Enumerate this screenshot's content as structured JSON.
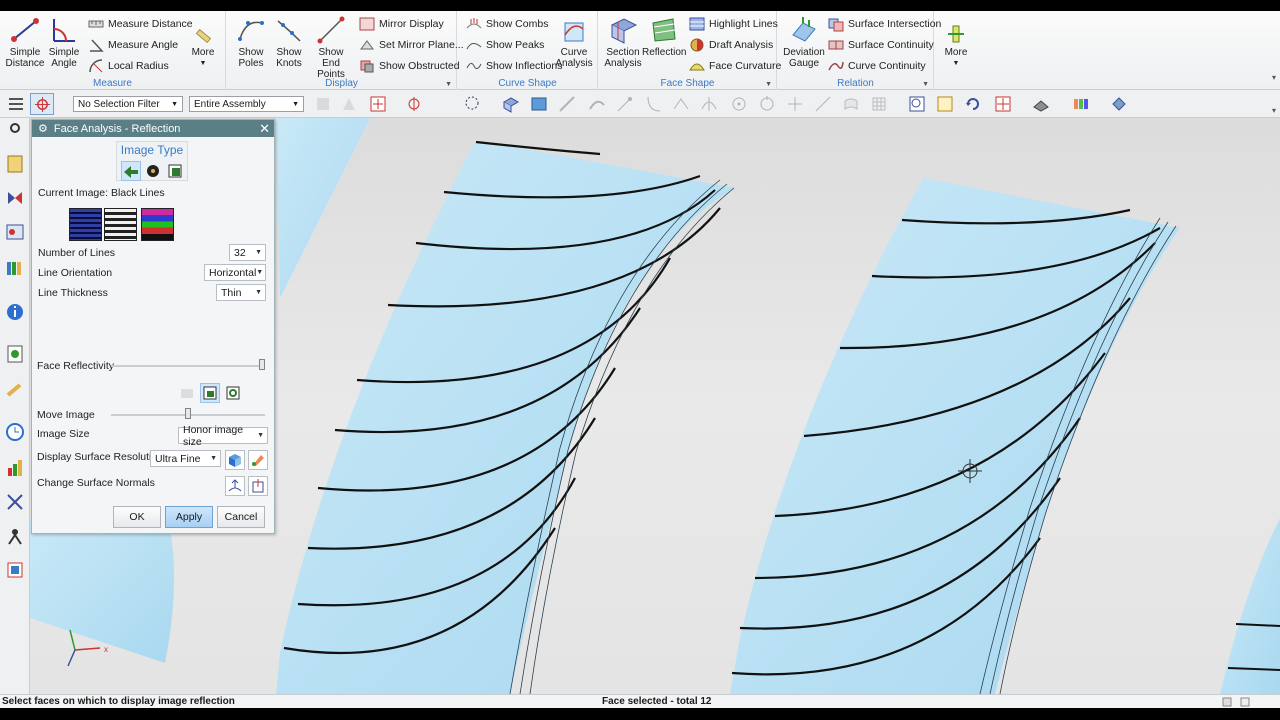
{
  "ribbon": {
    "measure": {
      "label": "Measure",
      "simple_distance": "Simple Distance",
      "simple_angle": "Simple Angle",
      "measure_distance": "Measure Distance",
      "measure_angle": "Measure Angle",
      "local_radius": "Local Radius",
      "more": "More"
    },
    "display": {
      "label": "Display",
      "show_poles": "Show Poles",
      "show_knots": "Show Knots",
      "show_end_points": "Show End Points",
      "mirror_display": "Mirror Display",
      "set_mirror_plane": "Set Mirror Plane...",
      "show_obstructed": "Show Obstructed"
    },
    "curve_shape": {
      "label": "Curve Shape",
      "show_combs": "Show Combs",
      "show_peaks": "Show Peaks",
      "show_inflections": "Show Inflections",
      "curve_analysis": "Curve Analysis"
    },
    "face_shape": {
      "label": "Face Shape",
      "section_analysis": "Section Analysis",
      "reflection": "Reflection",
      "highlight_lines": "Highlight Lines",
      "draft_analysis": "Draft Analysis",
      "face_curvature": "Face Curvature"
    },
    "relation": {
      "label": "Relation",
      "deviation_gauge": "Deviation Gauge",
      "surface_intersection": "Surface Intersection",
      "surface_continuity": "Surface Continuity",
      "curve_continuity": "Curve Continuity"
    },
    "more": "More"
  },
  "toolbar": {
    "selection_filter": "No Selection Filter",
    "scope": "Entire Assembly"
  },
  "dialog": {
    "title": "Face Analysis - Reflection",
    "image_type_label": "Image Type",
    "current_image": "Current Image: Black Lines",
    "number_of_lines_label": "Number of Lines",
    "number_of_lines": "32",
    "line_orientation_label": "Line Orientation",
    "line_orientation": "Horizontal",
    "line_thickness_label": "Line Thickness",
    "line_thickness": "Thin",
    "face_reflectivity_label": "Face Reflectivity",
    "face_reflectivity": 1.0,
    "move_image_label": "Move Image",
    "move_image": 0.5,
    "image_size_label": "Image Size",
    "image_size": "Honor image size",
    "display_resolution_label": "Display Surface Resolution",
    "display_resolution": "Ultra Fine",
    "change_normals_label": "Change Surface Normals",
    "ok": "OK",
    "apply": "Apply",
    "cancel": "Cancel"
  },
  "status": {
    "prompt": "Select faces on which to display image reflection",
    "selection": "Face selected - total 12"
  },
  "colors": {
    "accent": "#3b7bc4",
    "dialog_title": "#5a7f86",
    "surface": "#bfe3f4"
  }
}
